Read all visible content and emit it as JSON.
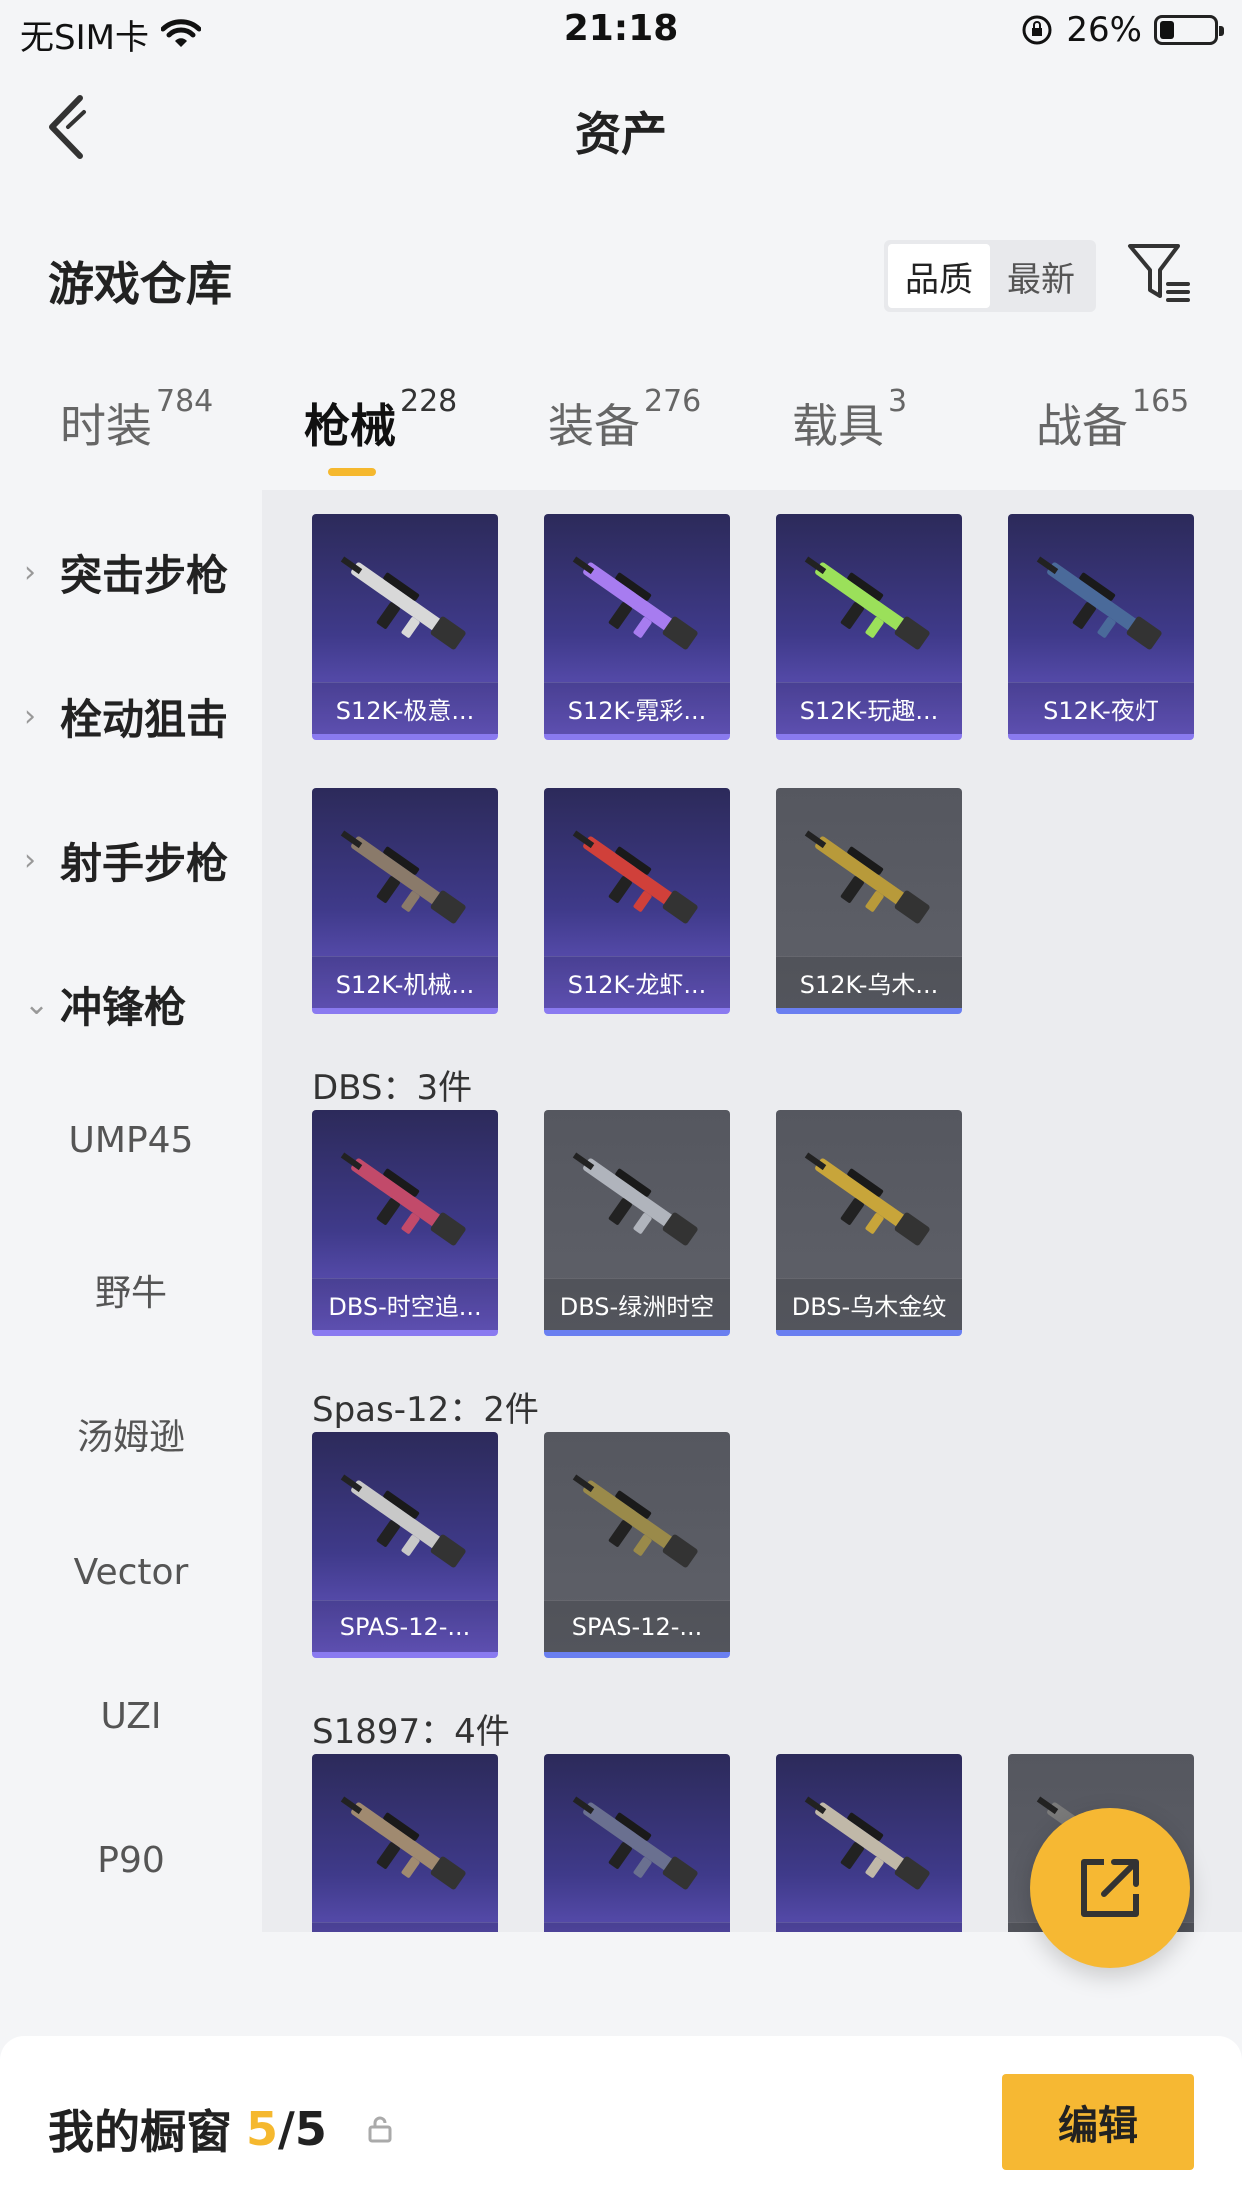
{
  "status_bar": {
    "carrier": "无SIM卡",
    "time": "21:18",
    "battery_pct": "26%",
    "battery_level": 0.26
  },
  "nav": {
    "title": "资产"
  },
  "warehouse": {
    "title": "游戏仓库",
    "sort_options": [
      "品质",
      "最新"
    ],
    "active_sort": "品质"
  },
  "tabs": [
    {
      "label": "时装",
      "count": "784",
      "active": false
    },
    {
      "label": "枪械",
      "count": "228",
      "active": true
    },
    {
      "label": "装备",
      "count": "276",
      "active": false
    },
    {
      "label": "载具",
      "count": "3",
      "active": false
    },
    {
      "label": "战备",
      "count": "165",
      "active": false
    }
  ],
  "sidebar": {
    "categories": [
      {
        "label": "突击步枪",
        "expanded": false
      },
      {
        "label": "栓动狙击",
        "expanded": false
      },
      {
        "label": "射手步枪",
        "expanded": false
      },
      {
        "label": "冲锋枪",
        "expanded": true
      }
    ],
    "subcategories": [
      "UMP45",
      "野牛",
      "汤姆逊",
      "Vector",
      "UZI",
      "P90"
    ]
  },
  "groups": [
    {
      "title": "",
      "items": [
        {
          "label": "S12K-极意...",
          "rarity": "purple"
        },
        {
          "label": "S12K-霓彩...",
          "rarity": "purple"
        },
        {
          "label": "S12K-玩趣...",
          "rarity": "purple"
        },
        {
          "label": "S12K-夜灯",
          "rarity": "purple"
        },
        {
          "label": "S12K-机械...",
          "rarity": "purple"
        },
        {
          "label": "S12K-龙虾...",
          "rarity": "purple"
        },
        {
          "label": "S12K-乌木...",
          "rarity": "grey"
        }
      ]
    },
    {
      "title": "DBS：3件",
      "items": [
        {
          "label": "DBS-时空追...",
          "rarity": "purple"
        },
        {
          "label": "DBS-绿洲时空",
          "rarity": "grey"
        },
        {
          "label": "DBS-乌木金纹",
          "rarity": "grey"
        }
      ]
    },
    {
      "title": "Spas-12：2件",
      "items": [
        {
          "label": "SPAS-12-...",
          "rarity": "purple"
        },
        {
          "label": "SPAS-12-...",
          "rarity": "grey"
        }
      ]
    },
    {
      "title": "S1897：4件",
      "items": [
        {
          "label": "",
          "rarity": "purple"
        },
        {
          "label": "",
          "rarity": "purple"
        },
        {
          "label": "",
          "rarity": "purple"
        },
        {
          "label": "",
          "rarity": "grey"
        }
      ]
    }
  ],
  "bottom": {
    "title": "我的橱窗",
    "current": "5",
    "total": "/5",
    "edit_label": "编辑"
  },
  "colors": {
    "accent": "#f5b82e",
    "purple_card": "#3f3a8a",
    "grey_card": "#5a5c64"
  }
}
